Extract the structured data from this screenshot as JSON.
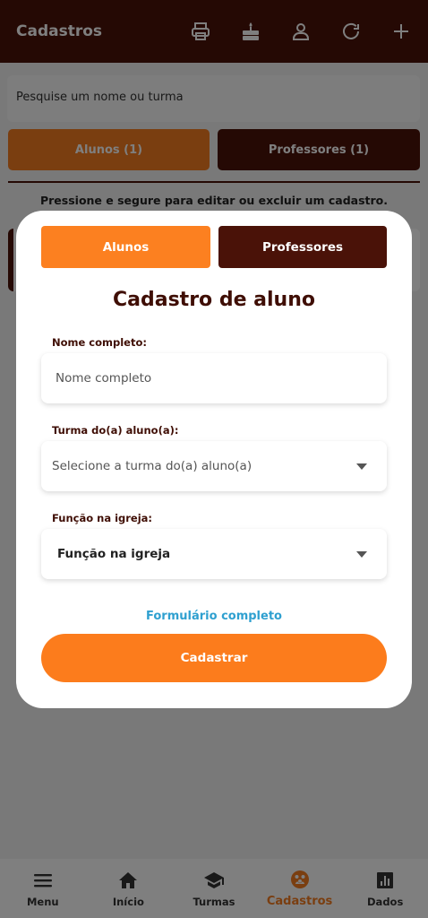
{
  "header": {
    "title": "Cadastros"
  },
  "header_icons": [
    "printer-icon",
    "cake-icon",
    "user-icon",
    "refresh-icon",
    "add-icon"
  ],
  "search": {
    "placeholder": "Pesquise um nome ou turma"
  },
  "tabs": {
    "alunos": "Alunos (1)",
    "professores": "Professores (1)"
  },
  "hint": "Pressione e segure para editar ou excluir um cadastro.",
  "modal": {
    "tab_alunos": "Alunos",
    "tab_professores": "Professores",
    "title": "Cadastro de aluno",
    "name_label": "Nome completo:",
    "name_placeholder": "Nome completo",
    "turma_label": "Turma do(a) aluno(a):",
    "turma_value": "Selecione a turma do(a) aluno(a)",
    "funcao_label": "Função na igreja:",
    "funcao_value": "Função na igreja",
    "link": "Formulário completo",
    "submit": "Cadastrar"
  },
  "nav": {
    "items": [
      {
        "label": "Menu",
        "icon": "menu-icon"
      },
      {
        "label": "Início",
        "icon": "home-icon"
      },
      {
        "label": "Turmas",
        "icon": "graduation-cap-icon"
      },
      {
        "label": "Cadastros",
        "icon": "people-icon",
        "active": true
      },
      {
        "label": "Dados",
        "icon": "chart-icon"
      }
    ]
  },
  "colors": {
    "brand_dark": "#4a1208",
    "brand_orange": "#fc8020",
    "link": "#2fa0d0"
  }
}
